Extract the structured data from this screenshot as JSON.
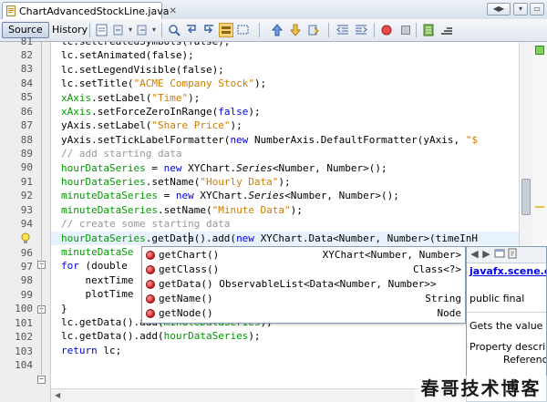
{
  "tab": {
    "filename": "ChartAdvancedStockLine.java",
    "close_glyph": "✕"
  },
  "tabbar_buttons": [
    "◀▶",
    "▾",
    "▭"
  ],
  "toolbar": {
    "source_label": "Source",
    "history_label": "History"
  },
  "editor": {
    "line_numbers": [
      "81",
      "82",
      "83",
      "84",
      "85",
      "86",
      "87",
      "88",
      "89",
      "90",
      "91",
      "92",
      "93",
      "94",
      "95",
      "96",
      "97",
      "98",
      "99",
      "100",
      "101",
      "102",
      "103",
      "104"
    ],
    "lines": [
      [
        {
          "t": "lc.setCreatedSymbols(false);",
          "c": ""
        }
      ],
      [
        {
          "t": "lc.setAnimated(false);",
          "c": ""
        }
      ],
      [
        {
          "t": "lc.setLegendVisible(false);",
          "c": ""
        }
      ],
      [
        {
          "t": "lc.setTitle(",
          "c": ""
        },
        {
          "t": "\"ACME Company Stock\"",
          "c": "str"
        },
        {
          "t": ");",
          "c": ""
        }
      ],
      [
        {
          "t": "xAxis",
          "c": "fld"
        },
        {
          "t": ".setLabel(",
          "c": ""
        },
        {
          "t": "\"Time\"",
          "c": "str"
        },
        {
          "t": ");",
          "c": ""
        }
      ],
      [
        {
          "t": "xAxis",
          "c": "fld"
        },
        {
          "t": ".setForceZeroInRange(",
          "c": ""
        },
        {
          "t": "false",
          "c": "kw"
        },
        {
          "t": ");",
          "c": ""
        }
      ],
      [
        {
          "t": "yAxis",
          "c": ""
        },
        {
          "t": ".setLabel(",
          "c": ""
        },
        {
          "t": "\"Share Price\"",
          "c": "str"
        },
        {
          "t": ");",
          "c": ""
        }
      ],
      [
        {
          "t": "yAxis.setTickLabelFormatter(",
          "c": ""
        },
        {
          "t": "new ",
          "c": "kw"
        },
        {
          "t": "NumberAxis.DefaultFormatter(yAxis, ",
          "c": ""
        },
        {
          "t": "\"$",
          "c": "str"
        }
      ],
      [
        {
          "t": "// add starting data",
          "c": "cm"
        }
      ],
      [
        {
          "t": "hourDataSeries",
          "c": "fld"
        },
        {
          "t": " = ",
          "c": ""
        },
        {
          "t": "new ",
          "c": "kw"
        },
        {
          "t": "XYChart.",
          "c": ""
        },
        {
          "t": "Series",
          "c": "it"
        },
        {
          "t": "<Number, Number>();",
          "c": ""
        }
      ],
      [
        {
          "t": "hourDataSeries",
          "c": "fld"
        },
        {
          "t": ".setName(",
          "c": ""
        },
        {
          "t": "\"Hourly Data\"",
          "c": "str"
        },
        {
          "t": ");",
          "c": ""
        }
      ],
      [
        {
          "t": "minuteDataSeries",
          "c": "fld"
        },
        {
          "t": " = ",
          "c": ""
        },
        {
          "t": "new ",
          "c": "kw"
        },
        {
          "t": "XYChart.",
          "c": ""
        },
        {
          "t": "Series",
          "c": "it"
        },
        {
          "t": "<Number, Number>();",
          "c": ""
        }
      ],
      [
        {
          "t": "minuteDataSeries",
          "c": "fld"
        },
        {
          "t": ".setName(",
          "c": ""
        },
        {
          "t": "\"Minute Data\"",
          "c": "str"
        },
        {
          "t": ");",
          "c": ""
        }
      ],
      [
        {
          "t": "// create some starting data",
          "c": "cm"
        }
      ],
      [
        {
          "t": "hourDataSeries",
          "c": "fld"
        },
        {
          "t": ".getData().add(",
          "c": ""
        },
        {
          "t": "new ",
          "c": "kw"
        },
        {
          "t": "XYChart.Data<Number, Number>(timeInH",
          "c": ""
        }
      ],
      [
        {
          "t": "minuteDataSe",
          "c": "fld"
        }
      ],
      [
        {
          "t": "for ",
          "c": "kw"
        },
        {
          "t": "(double",
          "c": ""
        }
      ],
      [
        {
          "t": "    nextTime",
          "c": ""
        }
      ],
      [
        {
          "t": "    plotTime",
          "c": ""
        }
      ],
      [
        {
          "t": "}",
          "c": ""
        }
      ],
      [
        {
          "t": "lc.getData().add(",
          "c": ""
        },
        {
          "t": "minuteDataSeries",
          "c": "fld"
        },
        {
          "t": ");",
          "c": ""
        }
      ],
      [
        {
          "t": "lc.getData().add(",
          "c": ""
        },
        {
          "t": "hourDataSeries",
          "c": "fld"
        },
        {
          "t": ");",
          "c": ""
        }
      ],
      [
        {
          "t": "return ",
          "c": "kw"
        },
        {
          "t": "lc;",
          "c": ""
        }
      ],
      [
        {
          "t": "}",
          "c": ""
        }
      ]
    ]
  },
  "completion": {
    "items": [
      {
        "name": "getChart()",
        "type": "XYChart<Number, Number>",
        "selected": true
      },
      {
        "name": "getClass()",
        "type": "Class<?>",
        "selected": false
      },
      {
        "name": "getData() ObservableList<Data<Number, Number>>",
        "type": "",
        "selected": false
      },
      {
        "name": "getName()",
        "type": "String",
        "selected": false
      },
      {
        "name": "getNode()",
        "type": "Node",
        "selected": false
      }
    ]
  },
  "javadoc": {
    "link": "javafx.scene.c",
    "line1": "public final",
    "line2": "Gets the value of",
    "line3": "Property descrip",
    "line4": "Referenc"
  },
  "watermark": "春哥技术博客",
  "colors": {
    "keyword": "#0000e6",
    "string": "#ce7b00",
    "comment": "#969696",
    "field": "#009900",
    "selection": "#3875d7"
  }
}
